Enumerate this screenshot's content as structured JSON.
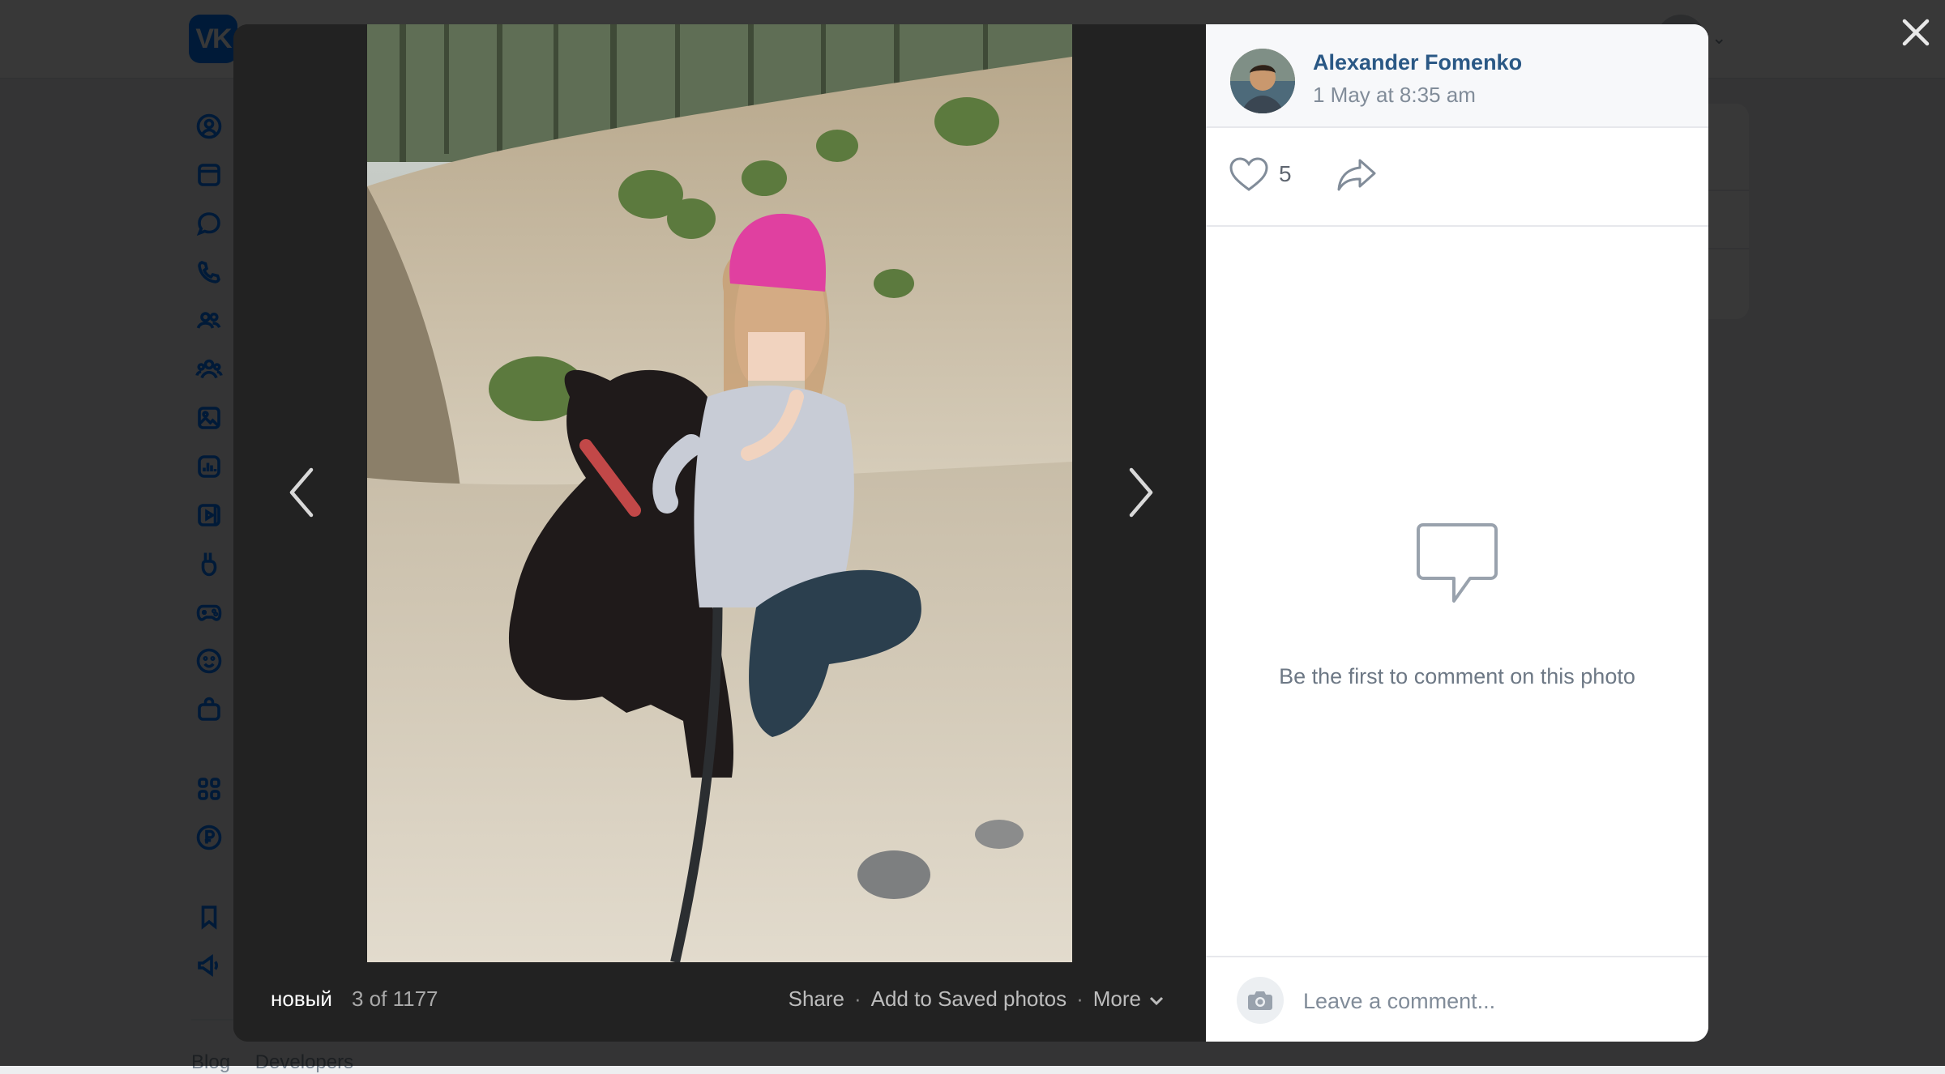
{
  "background": {
    "logo_text": "VK",
    "footer_links": [
      "Blog",
      "Developers"
    ],
    "nav_icons": [
      "profile-icon",
      "news-icon",
      "messenger-icon",
      "calls-icon",
      "friends-icon",
      "communities-icon",
      "photos-icon",
      "music-icon",
      "video-icon",
      "clips-icon",
      "games-icon",
      "stickers-icon",
      "market-icon",
      "apps-icon",
      "vk-pay-icon",
      "bookmarks-icon",
      "ads-icon"
    ]
  },
  "viewer": {
    "album_name": "новый",
    "counter": "3 of 1177",
    "actions": {
      "share": "Share",
      "save": "Add to Saved photos",
      "more": "More"
    }
  },
  "panel": {
    "author_name": "Alexander Fomenko",
    "date": "1 May at 8:35 am",
    "likes": "5",
    "empty_text": "Be the first to comment on this photo",
    "comment_placeholder": "Leave a comment..."
  },
  "colors": {
    "accent": "#0077ff",
    "link": "#2a5885",
    "panel_bg": "#ffffff",
    "viewer_bg": "#222222"
  }
}
